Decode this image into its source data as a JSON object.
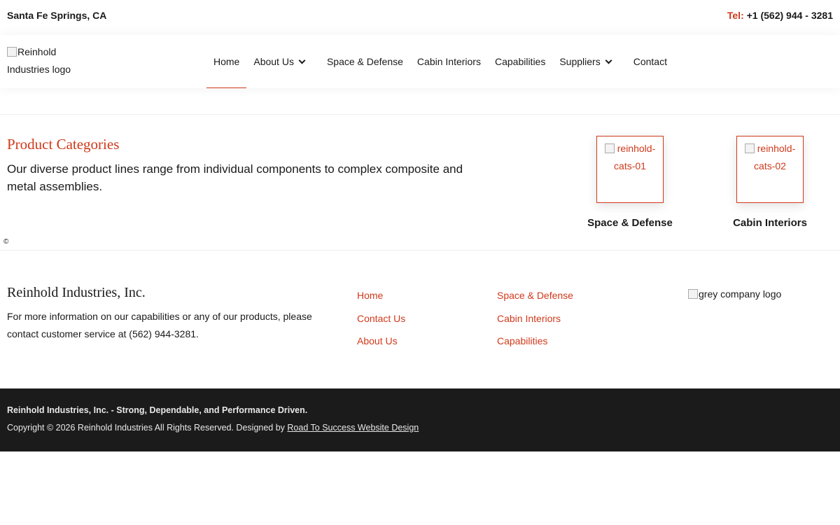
{
  "topbar": {
    "location": "Santa Fe Springs, CA",
    "tel_label": "Tel:",
    "tel_number": "+1 (562) 944 - 3281"
  },
  "header": {
    "logo_alt": "Reinhold Industries logo",
    "nav": [
      {
        "label": "Home",
        "active": true,
        "dropdown": false
      },
      {
        "label": "About Us",
        "active": false,
        "dropdown": true
      },
      {
        "label": "Space & Defense",
        "active": false,
        "dropdown": false
      },
      {
        "label": "Cabin Interiors",
        "active": false,
        "dropdown": false
      },
      {
        "label": "Capabilities",
        "active": false,
        "dropdown": false
      },
      {
        "label": "Suppliers",
        "active": false,
        "dropdown": true
      },
      {
        "label": "Contact",
        "active": false,
        "dropdown": false
      }
    ]
  },
  "categories": {
    "title": "Product Categories",
    "description": "Our diverse product lines range from individual components to complex composite and metal assemblies.",
    "cards": [
      {
        "image_alt": "reinhold-cats-01",
        "label": "Space & Defense"
      },
      {
        "image_alt": "reinhold-cats-02",
        "label": "Cabin Interiors"
      }
    ],
    "copyright_symbol": "©"
  },
  "footer": {
    "company_name": "Reinhold Industries, Inc.",
    "info": "For more information on our capabilities or any of our products, please contact customer service at (562) 944-3281.",
    "links_col1": [
      "Home",
      "Contact Us",
      "About Us"
    ],
    "links_col2": [
      "Space & Defense",
      "Cabin Interiors",
      "Capabilities"
    ],
    "logo_alt": "grey company logo"
  },
  "bottombar": {
    "tagline": "Reinhold Industries, Inc. - Strong, Dependable, and Performance Driven.",
    "copyright_prefix": "Copyright © 2026 Reinhold Industries All Rights Reserved. Designed by ",
    "designer_link": "Road To Success Website Design"
  },
  "colors": {
    "accent": "#d0391b",
    "text": "#1a1a1a",
    "footer_bg": "#1b1b1b"
  }
}
